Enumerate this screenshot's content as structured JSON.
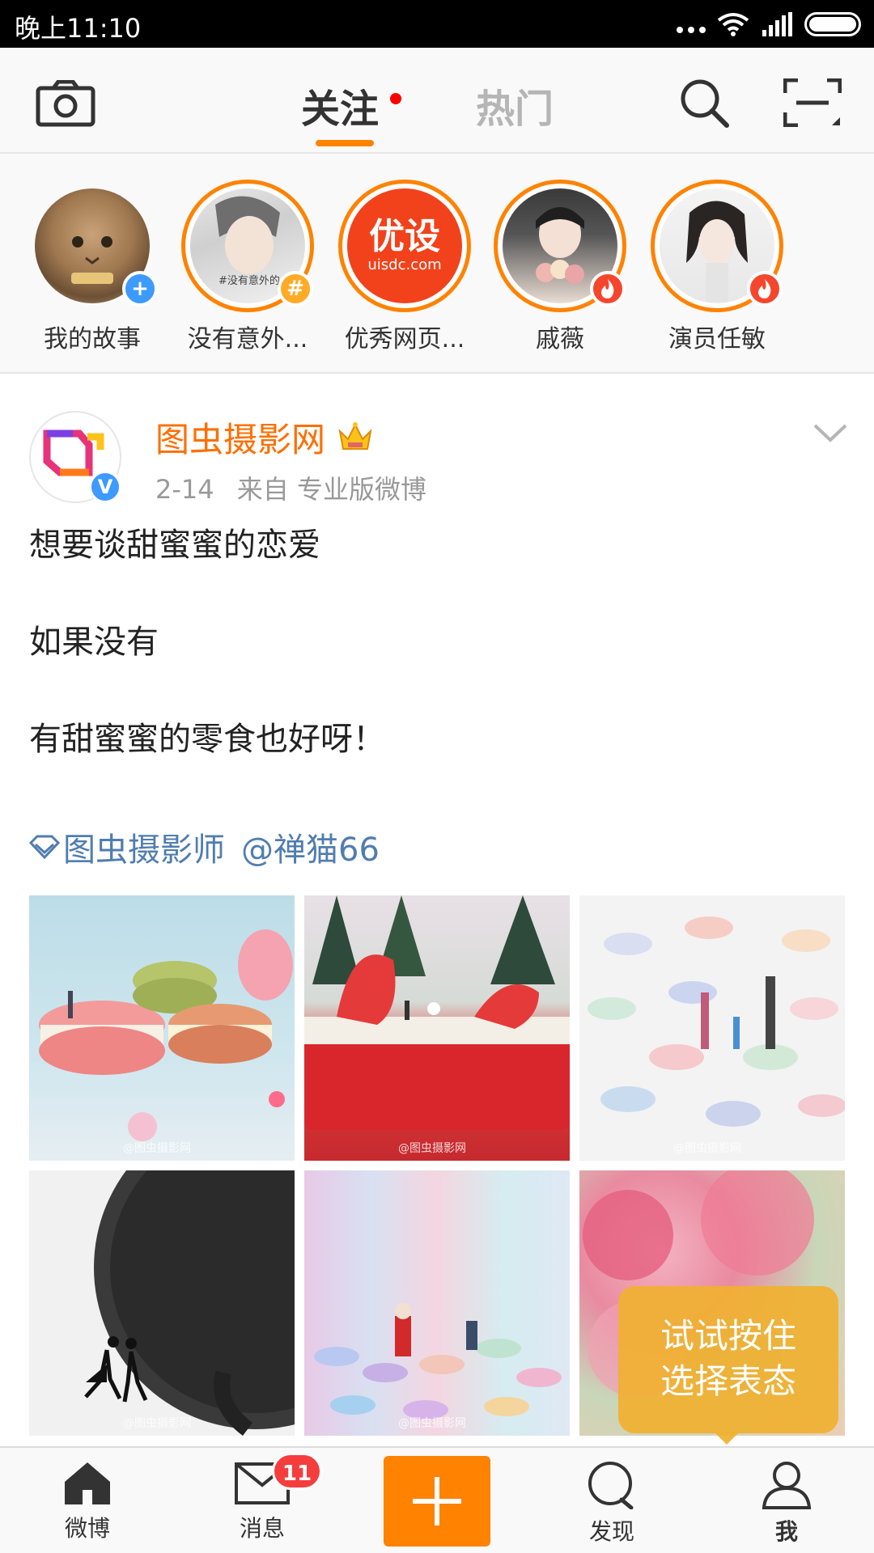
{
  "status_bar": {
    "time": "晚上11:10"
  },
  "top_nav": {
    "tab_follow": "关注",
    "tab_hot": "热门"
  },
  "stories": [
    {
      "label": "我的故事",
      "badge": "+",
      "badge_color": "#3d9aff"
    },
    {
      "label": "没有意外...",
      "badge": "#",
      "badge_color": "#ffab28"
    },
    {
      "label": "优秀网页...",
      "logo_text": "优设",
      "logo_sub": "uisdc.com"
    },
    {
      "label": "戚薇",
      "badge": "fire",
      "badge_color": "#f5462d"
    },
    {
      "label": "演员任敏",
      "badge": "fire",
      "badge_color": "#f5462d"
    }
  ],
  "post": {
    "author": "图虫摄影网",
    "verified_badge": "V",
    "date": "2-14",
    "source": "来自 专业版微博",
    "lines": [
      "想要谈甜蜜蜜的恋爱",
      "如果没有",
      "有甜蜜蜜的零食也好呀！"
    ],
    "tag_badge": "图虫摄影师",
    "mention": "@禅猫66",
    "photos": [
      "macarons",
      "strawberry-cake",
      "candy-family",
      "clock-dancers",
      "santa-candies",
      "pink-flowers"
    ],
    "watermarks": [
      "@图虫摄影网",
      "@图虫摄影网",
      "@图虫摄影网",
      "@图虫摄影网",
      "@图虫摄影网"
    ]
  },
  "tooltip": {
    "line1": "试试按住",
    "line2": "选择表态"
  },
  "bottom_nav": {
    "home": "微博",
    "messages": "消息",
    "messages_badge": "11",
    "discover": "发现",
    "me": "我"
  },
  "colors": {
    "accent": "#ff8200",
    "link": "#507daf",
    "author": "#ff6e00"
  }
}
